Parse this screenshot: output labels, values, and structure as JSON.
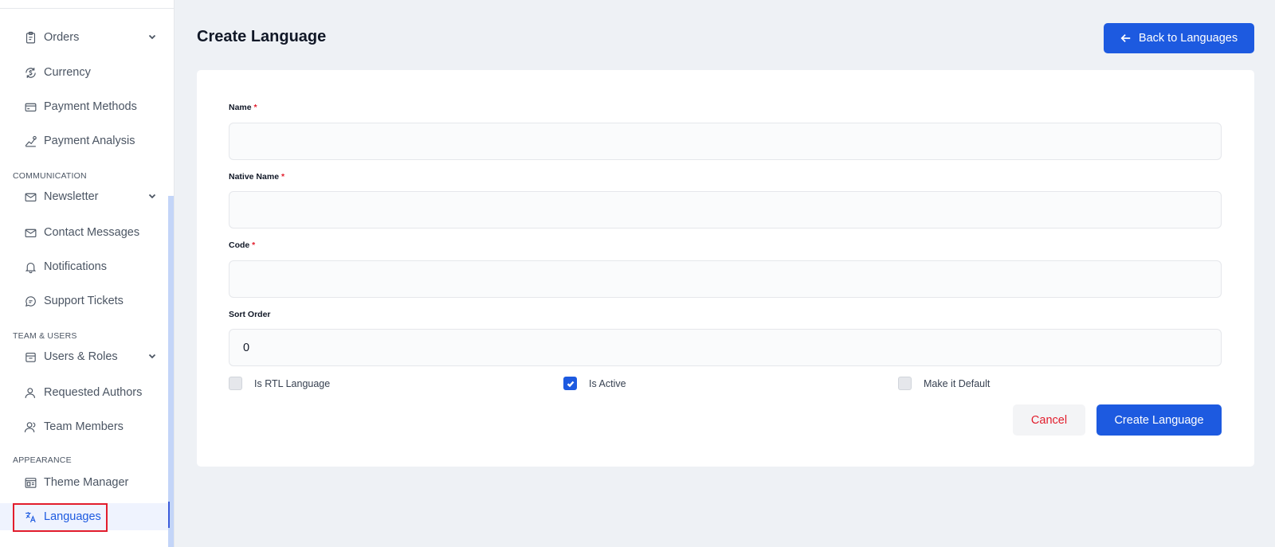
{
  "sidebar": {
    "items": [
      {
        "label": "Orders",
        "icon": "clipboard-icon"
      },
      {
        "label": "Currency",
        "icon": "currency-exchange-icon"
      },
      {
        "label": "Payment Methods",
        "icon": "credit-card-icon"
      },
      {
        "label": "Payment Analysis",
        "icon": "chart-line-icon"
      },
      {
        "label": "Newsletter",
        "icon": "mail-icon"
      },
      {
        "label": "Contact Messages",
        "icon": "envelope-icon"
      },
      {
        "label": "Notifications",
        "icon": "bell-icon"
      },
      {
        "label": "Support Tickets",
        "icon": "chat-icon"
      },
      {
        "label": "Users & Roles",
        "icon": "users-roles-icon"
      },
      {
        "label": "Requested Authors",
        "icon": "user-icon"
      },
      {
        "label": "Team Members",
        "icon": "user-group-icon"
      },
      {
        "label": "Theme Manager",
        "icon": "theme-icon"
      },
      {
        "label": "Languages",
        "icon": "translate-icon",
        "active": true
      }
    ],
    "sections": {
      "communication": "COMMUNICATION",
      "team_users": "TEAM & USERS",
      "appearance": "APPEARANCE"
    }
  },
  "header": {
    "title": "Create Language",
    "back_button": "Back to Languages"
  },
  "form": {
    "required_mark": "*",
    "name_label": "Name",
    "name_value": "",
    "native_name_label": "Native Name",
    "native_name_value": "",
    "code_label": "Code",
    "code_value": "",
    "sort_order_label": "Sort Order",
    "sort_order_value": "0",
    "rtl_label": "Is RTL Language",
    "rtl_checked": false,
    "active_label": "Is Active",
    "active_checked": true,
    "default_label": "Make it Default",
    "default_checked": false,
    "cancel_button": "Cancel",
    "submit_button": "Create Language"
  },
  "colors": {
    "primary": "#1d5ae0",
    "danger": "#e21d2c",
    "background": "#eef1f5"
  }
}
